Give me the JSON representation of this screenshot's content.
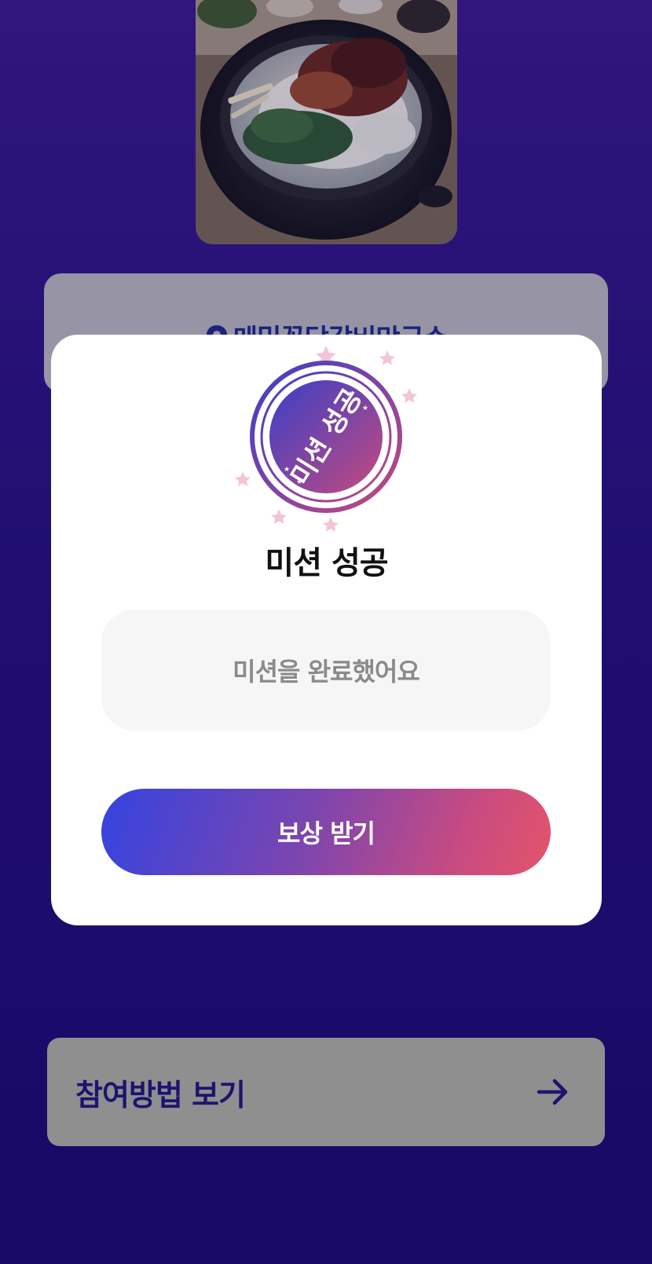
{
  "location_card": {
    "name": "메밀꽃닭갈비막국수",
    "icon": "map-pin-icon"
  },
  "food_photo": {
    "icon": "food-photo"
  },
  "modal": {
    "stamp_text": "미션 성공",
    "title": "미션 성공",
    "message": "미션을 완료했어요",
    "reward_button_label": "보상 받기"
  },
  "howto": {
    "label": "참여방법 보기",
    "icon": "arrow-right-icon"
  },
  "colors": {
    "background_top": "#3a1a8a",
    "background_bottom": "#1a0a6c",
    "button_gradient_start": "#3444e0",
    "button_gradient_end": "#e4546a",
    "title_text": "#111111",
    "howto_text": "#1d1470"
  }
}
